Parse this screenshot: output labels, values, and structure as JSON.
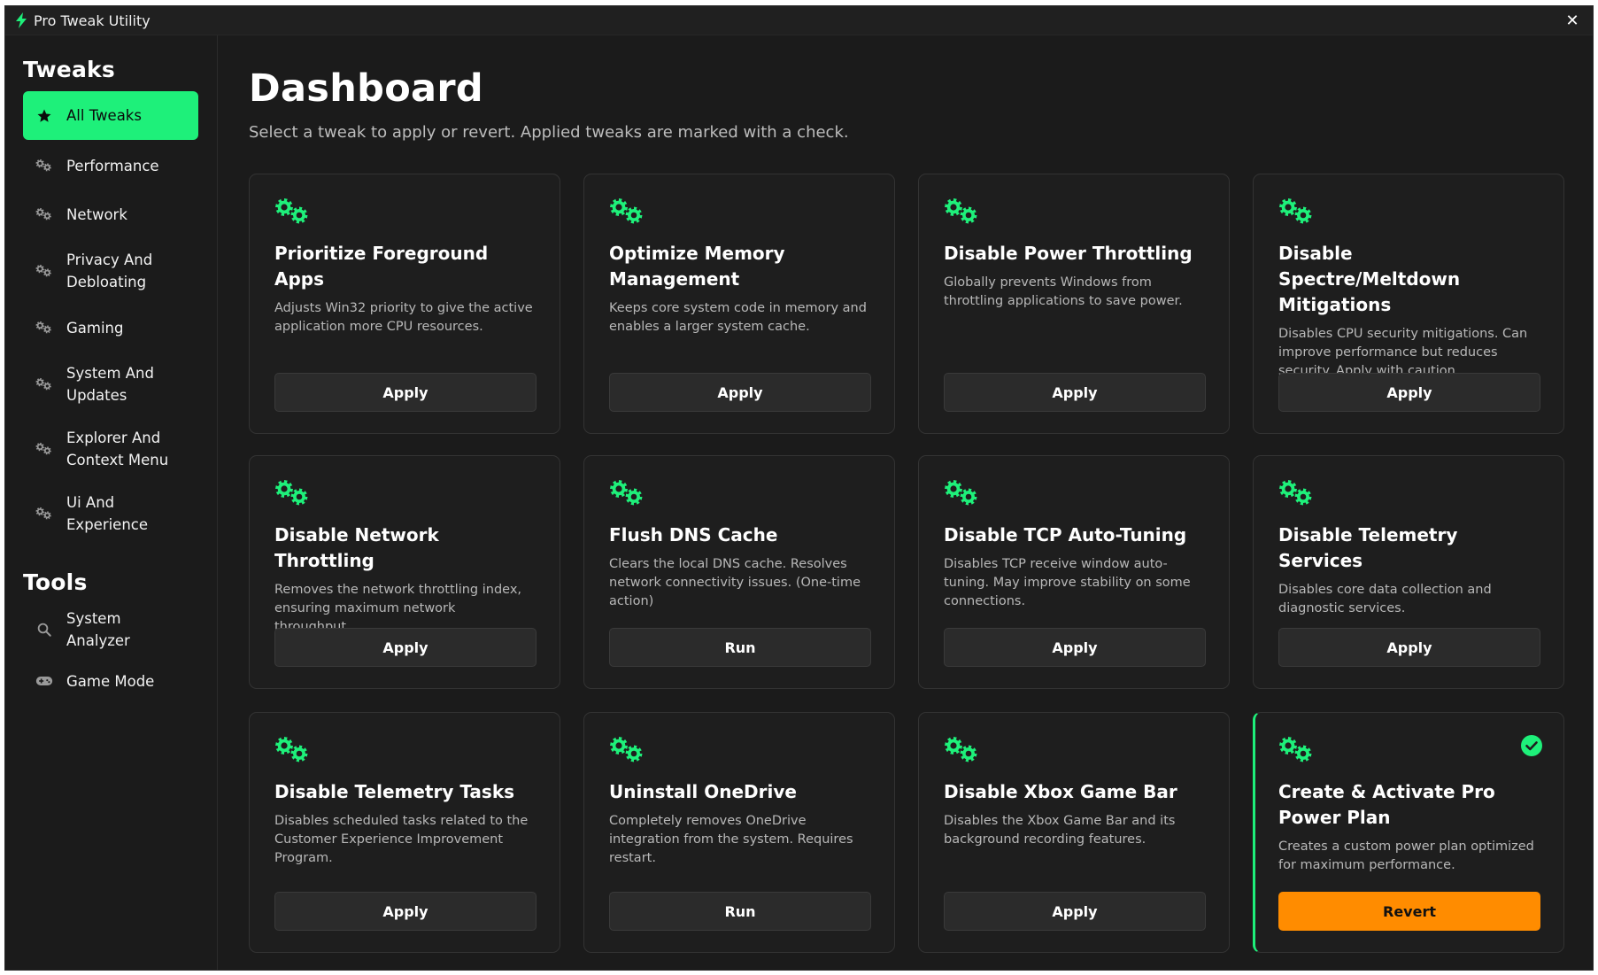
{
  "window": {
    "title": "Pro Tweak Utility",
    "close_glyph": "✕"
  },
  "sidebar": {
    "tweaks_heading": "Tweaks",
    "tweak_items": [
      {
        "label": "All Tweaks",
        "icon": "star-icon",
        "active": true
      },
      {
        "label": "Performance",
        "icon": "gears-icon"
      },
      {
        "label": "Network",
        "icon": "gears-icon"
      },
      {
        "label": "Privacy And Debloating",
        "icon": "gears-icon"
      },
      {
        "label": "Gaming",
        "icon": "gears-icon"
      },
      {
        "label": "System And Updates",
        "icon": "gears-icon"
      },
      {
        "label": "Explorer And Context Menu",
        "icon": "gears-icon"
      },
      {
        "label": "Ui And Experience",
        "icon": "gears-icon"
      }
    ],
    "tools_heading": "Tools",
    "tool_items": [
      {
        "label": "System Analyzer",
        "icon": "search-icon"
      },
      {
        "label": "Game Mode",
        "icon": "gamepad-icon"
      }
    ]
  },
  "main": {
    "title": "Dashboard",
    "subtitle": "Select a tweak to apply or revert. Applied tweaks are marked with a check.",
    "cards": [
      {
        "title": "Prioritize Foreground Apps",
        "description": "Adjusts Win32 priority to give the active application more CPU resources.",
        "button": "Apply"
      },
      {
        "title": "Optimize Memory Management",
        "description": "Keeps core system code in memory and enables a larger system cache.",
        "button": "Apply"
      },
      {
        "title": "Disable Power Throttling",
        "description": "Globally prevents Windows from throttling applications to save power.",
        "button": "Apply"
      },
      {
        "title": "Disable Spectre/Meltdown Mitigations",
        "description": "Disables CPU security mitigations. Can improve performance but reduces security. Apply with caution.",
        "button": "Apply"
      },
      {
        "title": "Disable Network Throttling",
        "description": "Removes the network throttling index, ensuring maximum network throughput.",
        "button": "Apply"
      },
      {
        "title": "Flush DNS Cache",
        "description": "Clears the local DNS cache. Resolves network connectivity issues. (One-time action)",
        "button": "Run"
      },
      {
        "title": "Disable TCP Auto-Tuning",
        "description": "Disables TCP receive window auto-tuning. May improve stability on some connections.",
        "button": "Apply"
      },
      {
        "title": "Disable Telemetry Services",
        "description": "Disables core data collection and diagnostic services.",
        "button": "Apply"
      },
      {
        "title": "Disable Telemetry Tasks",
        "description": "Disables scheduled tasks related to the Customer Experience Improvement Program.",
        "button": "Apply"
      },
      {
        "title": "Uninstall OneDrive",
        "description": "Completely removes OneDrive integration from the system. Requires restart.",
        "button": "Run"
      },
      {
        "title": "Disable Xbox Game Bar",
        "description": "Disables the Xbox Game Bar and its background recording features.",
        "button": "Apply"
      },
      {
        "title": "Create & Activate Pro Power Plan",
        "description": "Creates a custom power plan optimized for maximum performance.",
        "button": "Revert",
        "applied": true
      }
    ]
  },
  "colors": {
    "accent_green": "#1ef07a",
    "revert_orange": "#ff8c00",
    "background": "#1b1b1b",
    "card_background": "#1e1e1e"
  }
}
